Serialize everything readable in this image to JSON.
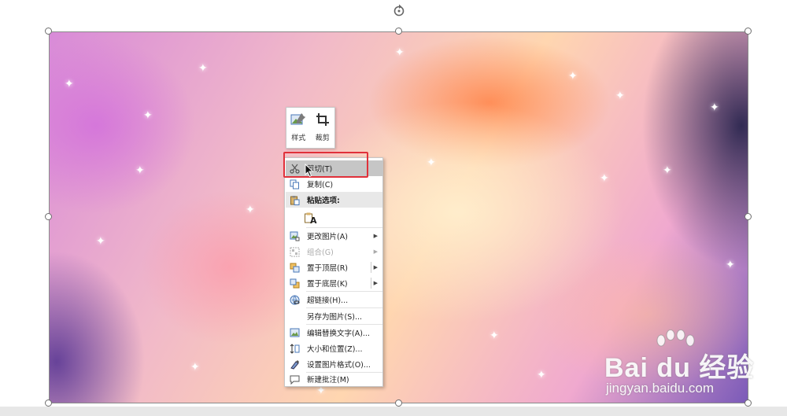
{
  "mini_toolbar": {
    "style_label": "样式",
    "crop_label": "裁剪"
  },
  "context_menu": {
    "items": [
      {
        "label": "剪切(T)",
        "icon": "scissors-icon",
        "state": "hover"
      },
      {
        "label": "复制(C)",
        "icon": "copy-icon",
        "state": "normal"
      },
      {
        "label": "粘贴选项:",
        "icon": "paste-icon",
        "state": "header"
      },
      {
        "label": "A",
        "icon": "paste-text-only-icon",
        "state": "paste-option"
      },
      {
        "label": "更改图片(A)",
        "icon": "change-picture-icon",
        "state": "submenu"
      },
      {
        "label": "组合(G)",
        "icon": "group-icon",
        "state": "disabled-submenu"
      },
      {
        "label": "置于顶层(R)",
        "icon": "bring-to-front-icon",
        "state": "split-submenu"
      },
      {
        "label": "置于底层(K)",
        "icon": "send-to-back-icon",
        "state": "split-submenu"
      },
      {
        "label": "超链接(H)...",
        "icon": "hyperlink-icon",
        "state": "normal"
      },
      {
        "label": "另存为图片(S)...",
        "icon": "",
        "state": "normal"
      },
      {
        "label": "编辑替换文字(A)...",
        "icon": "alt-text-icon",
        "state": "normal"
      },
      {
        "label": "大小和位置(Z)...",
        "icon": "size-position-icon",
        "state": "normal"
      },
      {
        "label": "设置图片格式(O)...",
        "icon": "format-picture-icon",
        "state": "normal"
      },
      {
        "label": "新建批注(M)",
        "icon": "new-comment-icon",
        "state": "normal"
      }
    ]
  },
  "watermark": {
    "brand": "Bai  du 经验",
    "url": "jingyan.baidu.com"
  },
  "colors": {
    "highlight_box": "#e0303a",
    "menu_hover": "#c6c6c6"
  }
}
